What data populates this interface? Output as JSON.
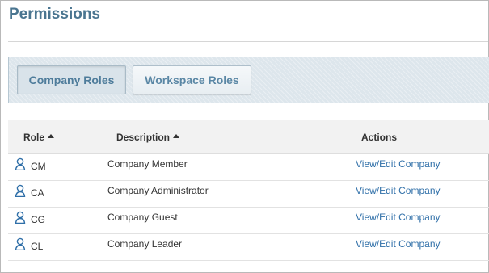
{
  "page": {
    "title": "Permissions"
  },
  "tabs": [
    {
      "label": "Company Roles",
      "active": true
    },
    {
      "label": "Workspace Roles",
      "active": false
    }
  ],
  "table": {
    "columns": {
      "role": "Role",
      "description": "Description",
      "actions": "Actions"
    },
    "rows": [
      {
        "icon": "user-icon",
        "role": "CM",
        "description": "Company Member",
        "action": "View/Edit Company"
      },
      {
        "icon": "user-icon",
        "role": "CA",
        "description": "Company Administrator",
        "action": "View/Edit Company"
      },
      {
        "icon": "user-icon",
        "role": "CG",
        "description": "Company Guest",
        "action": "View/Edit Company"
      },
      {
        "icon": "user-icon",
        "role": "CL",
        "description": "Company Leader",
        "action": "View/Edit Company"
      }
    ]
  },
  "colors": {
    "title": "#4a7590",
    "link": "#2f6fa8",
    "tab_text": "#5a87a5"
  }
}
